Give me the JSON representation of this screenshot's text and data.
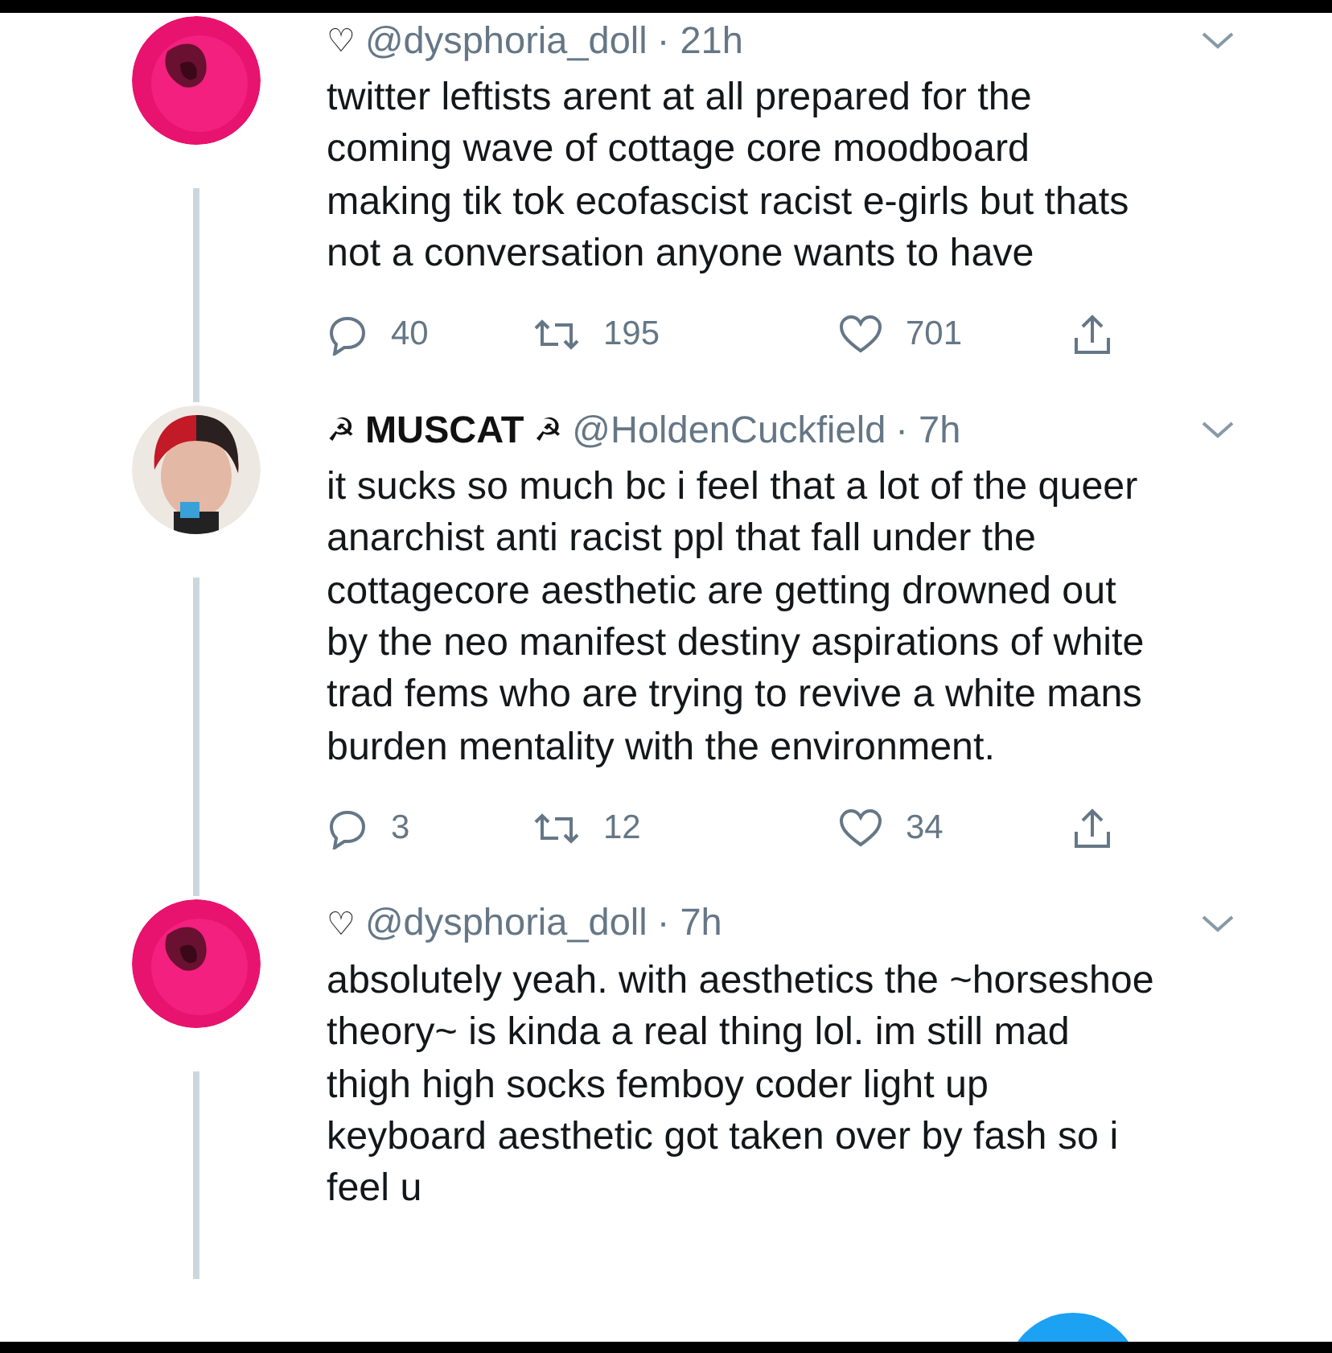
{
  "tweets": [
    {
      "avatar": {
        "kind": "pink"
      },
      "badge": "♡",
      "handle": "@dysphoria_doll",
      "time": "· 21h",
      "text": "twitter leftists arent at all prepared for the coming wave of cottage core moodboard making tik tok ecofascist racist e-girls but thats not a conversation anyone wants to have",
      "replies": "40",
      "retweets": "195",
      "likes": "701"
    },
    {
      "avatar": {
        "kind": "portrait"
      },
      "badge": "☭",
      "display_name": "MUSCAT",
      "handle": "@HoldenCuckfield",
      "time": "· 7h",
      "text": "it sucks so much bc i feel that a lot of the queer anarchist anti racist ppl that fall under the cottagecore aesthetic are getting drowned out by the neo manifest destiny aspirations of white trad fems who are trying to revive a white mans burden mentality with the environment.",
      "replies": "3",
      "retweets": "12",
      "likes": "34"
    },
    {
      "avatar": {
        "kind": "pink"
      },
      "badge": "♡",
      "handle": "@dysphoria_doll",
      "time": "· 7h",
      "text": "absolutely yeah. with aesthetics the ~horseshoe theory~ is kinda a real thing lol. im still mad thigh high socks femboy coder light up keyboard aesthetic got taken over by fash so i feel u"
    }
  ]
}
